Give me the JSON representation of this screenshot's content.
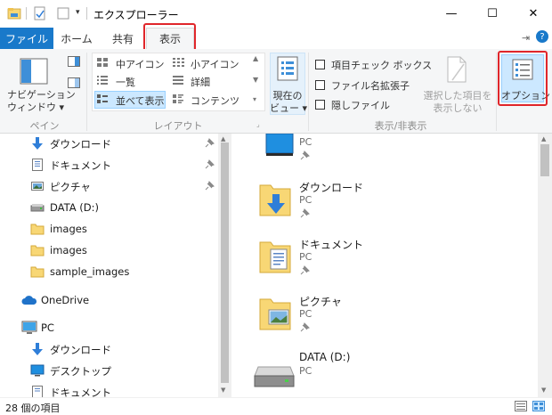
{
  "window": {
    "title": "エクスプローラー",
    "controls": {
      "minimize": "—",
      "maximize": "☐",
      "close": "✕"
    }
  },
  "tabs": {
    "file": "ファイル",
    "home": "ホーム",
    "share": "共有",
    "view": "表示"
  },
  "ribbon": {
    "pane_group": {
      "nav_pane_line1": "ナビゲーション",
      "nav_pane_line2": "ウィンドウ",
      "label": "ペイン"
    },
    "layout_group": {
      "medium_icons": "中アイコン",
      "small_icons": "小アイコン",
      "list": "一覧",
      "details": "詳細",
      "tiles": "並べて表示",
      "content": "コンテンツ",
      "label": "レイアウト"
    },
    "current_view": {
      "line1": "現在の",
      "line2": "ビュー"
    },
    "show_hide_group": {
      "item_checkboxes": "項目チェック ボックス",
      "file_extensions": "ファイル名拡張子",
      "hidden_items": "隠しファイル",
      "hide_selected_line1": "選択した項目を",
      "hide_selected_line2": "表示しない",
      "label": "表示/非表示"
    },
    "options": "オプション"
  },
  "nav": {
    "items": [
      {
        "label": "ダウンロード",
        "pinned": true
      },
      {
        "label": "ドキュメント",
        "pinned": true
      },
      {
        "label": "ピクチャ",
        "pinned": true
      },
      {
        "label": "DATA (D:)",
        "pinned": false
      },
      {
        "label": "images",
        "pinned": false
      },
      {
        "label": "images",
        "pinned": false
      },
      {
        "label": "sample_images",
        "pinned": false
      }
    ],
    "onedrive": "OneDrive",
    "pc": "PC",
    "pc_children": [
      "ダウンロード",
      "デスクトップ",
      "ドキュメント"
    ]
  },
  "content": {
    "items": [
      {
        "title": "",
        "sub": "PC",
        "pinned": true
      },
      {
        "title": "ダウンロード",
        "sub": "PC",
        "pinned": true
      },
      {
        "title": "ドキュメント",
        "sub": "PC",
        "pinned": true
      },
      {
        "title": "ピクチャ",
        "sub": "PC",
        "pinned": true
      },
      {
        "title": "DATA (D:)",
        "sub": "PC",
        "pinned": false
      }
    ]
  },
  "status": {
    "text": "28 個の項目"
  },
  "colors": {
    "accent": "#1979ca",
    "highlight": "#e0262b",
    "selected": "#cce8ff",
    "folder": "#f8d775"
  }
}
